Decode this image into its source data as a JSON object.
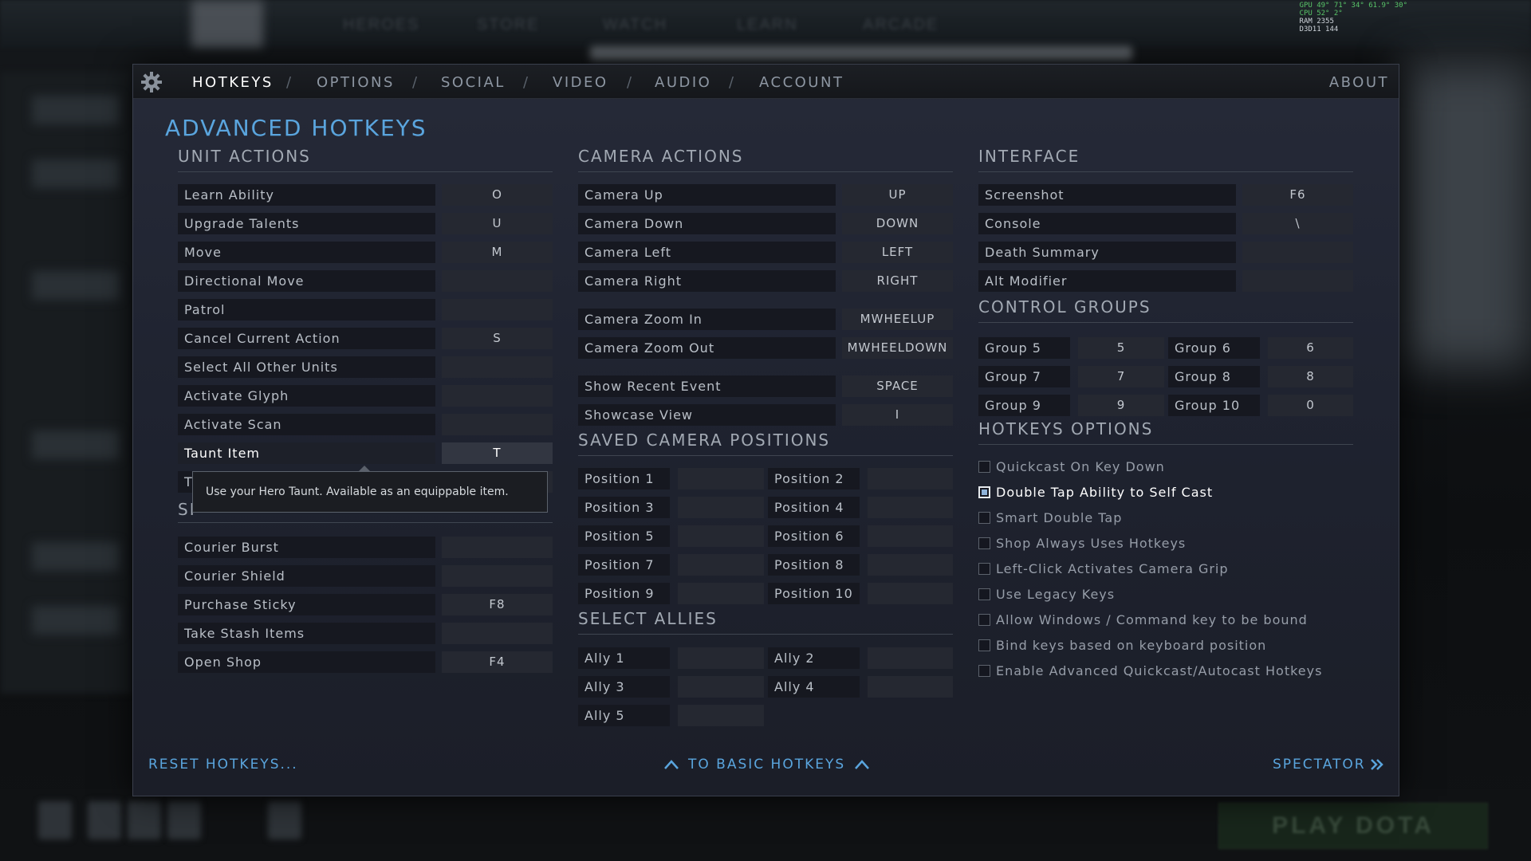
{
  "background": {
    "nav_items": [
      "HEROES",
      "STORE",
      "WATCH",
      "LEARN",
      "ARCADE"
    ],
    "play_button": "PLAY DOTA",
    "stats_lines": [
      "GPU  49°  71°  34°  61.9°  30°",
      "CPU  52°  2°",
      "RAM  2355",
      "D3D11  144"
    ]
  },
  "tabs": [
    {
      "label": "HOTKEYS",
      "active": true
    },
    {
      "label": "OPTIONS",
      "active": false
    },
    {
      "label": "SOCIAL",
      "active": false
    },
    {
      "label": "VIDEO",
      "active": false
    },
    {
      "label": "AUDIO",
      "active": false
    },
    {
      "label": "ACCOUNT",
      "active": false
    }
  ],
  "separator": "/",
  "about_label": "ABOUT",
  "page_title": "ADVANCED HOTKEYS",
  "unit_actions": {
    "title": "UNIT ACTIONS",
    "rows": [
      {
        "label": "Learn Ability",
        "key": "O"
      },
      {
        "label": "Upgrade Talents",
        "key": "U"
      },
      {
        "label": "Move",
        "key": "M"
      },
      {
        "label": "Directional Move",
        "key": ""
      },
      {
        "label": "Patrol",
        "key": ""
      },
      {
        "label": "Cancel Current Action",
        "key": "S"
      },
      {
        "label": "Select All Other Units",
        "key": ""
      },
      {
        "label": "Activate Glyph",
        "key": ""
      },
      {
        "label": "Activate Scan",
        "key": ""
      },
      {
        "label": "Taunt Item",
        "key": "T",
        "highlighted": true
      },
      {
        "label": "T",
        "key": ""
      }
    ]
  },
  "tooltip": "Use your Hero Taunt. Available as an equippable item.",
  "shop_section": {
    "title_fragment": "SI",
    "rows": [
      {
        "label": "Courier Burst",
        "key": ""
      },
      {
        "label": "Courier Shield",
        "key": ""
      },
      {
        "label": "Purchase Sticky",
        "key": "F8"
      },
      {
        "label": "Take Stash Items",
        "key": ""
      },
      {
        "label": "Open Shop",
        "key": "F4"
      }
    ]
  },
  "camera_actions": {
    "title": "CAMERA ACTIONS",
    "rows": [
      {
        "label": "Camera Up",
        "key": "UP"
      },
      {
        "label": "Camera Down",
        "key": "DOWN"
      },
      {
        "label": "Camera Left",
        "key": "LEFT"
      },
      {
        "label": "Camera Right",
        "key": "RIGHT"
      },
      {
        "label": "Camera Zoom In",
        "key": "MWHEELUP"
      },
      {
        "label": "Camera Zoom Out",
        "key": "MWHEELDOWN"
      },
      {
        "label": "Show Recent Event",
        "key": "SPACE"
      },
      {
        "label": "Showcase View",
        "key": "I"
      }
    ]
  },
  "saved_camera_positions": {
    "title": "SAVED CAMERA POSITIONS",
    "rows": [
      {
        "label": "Position 1",
        "key": ""
      },
      {
        "label": "Position 2",
        "key": ""
      },
      {
        "label": "Position 3",
        "key": ""
      },
      {
        "label": "Position 4",
        "key": ""
      },
      {
        "label": "Position 5",
        "key": ""
      },
      {
        "label": "Position 6",
        "key": ""
      },
      {
        "label": "Position 7",
        "key": ""
      },
      {
        "label": "Position 8",
        "key": ""
      },
      {
        "label": "Position 9",
        "key": ""
      },
      {
        "label": "Position 10",
        "key": ""
      }
    ]
  },
  "select_allies": {
    "title": "SELECT ALLIES",
    "rows": [
      {
        "label": "Ally 1",
        "key": ""
      },
      {
        "label": "Ally 2",
        "key": ""
      },
      {
        "label": "Ally 3",
        "key": ""
      },
      {
        "label": "Ally 4",
        "key": ""
      },
      {
        "label": "Ally 5",
        "key": ""
      }
    ]
  },
  "interface": {
    "title": "INTERFACE",
    "rows": [
      {
        "label": "Screenshot",
        "key": "F6"
      },
      {
        "label": "Console",
        "key": "\\"
      },
      {
        "label": "Death Summary",
        "key": ""
      },
      {
        "label": "Alt Modifier",
        "key": ""
      }
    ]
  },
  "control_groups": {
    "title": "CONTROL GROUPS",
    "rows": [
      {
        "label": "Group 5",
        "key": "5"
      },
      {
        "label": "Group 6",
        "key": "6"
      },
      {
        "label": "Group 7",
        "key": "7"
      },
      {
        "label": "Group 8",
        "key": "8"
      },
      {
        "label": "Group 9",
        "key": "9"
      },
      {
        "label": "Group 10",
        "key": "0"
      }
    ]
  },
  "hotkeys_options": {
    "title": "HOTKEYS OPTIONS",
    "items": [
      {
        "label": "Quickcast On Key Down",
        "checked": false
      },
      {
        "label": "Double Tap Ability to Self Cast",
        "checked": true
      },
      {
        "label": "Smart Double Tap",
        "checked": false
      },
      {
        "label": "Shop Always Uses Hotkeys",
        "checked": false
      },
      {
        "label": "Left-Click Activates Camera Grip",
        "checked": false
      },
      {
        "label": "Use Legacy Keys",
        "checked": false
      },
      {
        "label": "Allow Windows / Command key to be bound",
        "checked": false
      },
      {
        "label": "Bind keys based on keyboard position",
        "checked": false
      },
      {
        "label": "Enable Advanced Quickcast/Autocast Hotkeys",
        "checked": false
      }
    ]
  },
  "footer": {
    "reset": "RESET HOTKEYS...",
    "basic": "TO BASIC HOTKEYS",
    "spectator": "SPECTATOR"
  },
  "colors": {
    "accent": "#5aa5de",
    "panel": "#1f2330",
    "label_bg": "#161820",
    "key_bg": "#252831"
  }
}
